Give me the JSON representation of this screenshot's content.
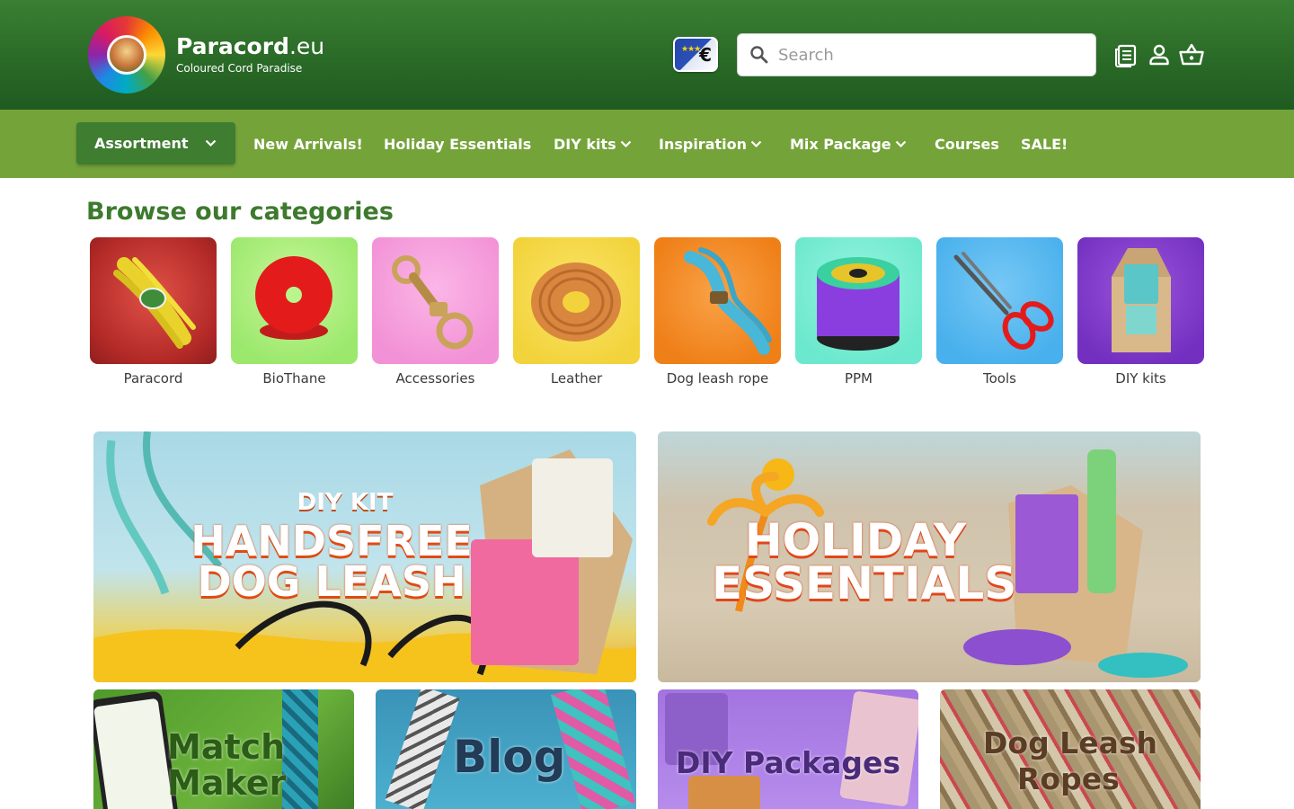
{
  "header": {
    "brand_name_bold": "Paracord",
    "brand_name_suffix": ".eu",
    "brand_tagline": "Coloured Cord Paradise",
    "region_symbol": "€",
    "search_placeholder": "Search"
  },
  "nav": {
    "assortment_label": "Assortment",
    "items": [
      {
        "label": "New Arrivals!",
        "has_dropdown": false
      },
      {
        "label": "Holiday Essentials",
        "has_dropdown": false
      },
      {
        "label": "DIY kits",
        "has_dropdown": true
      },
      {
        "label": "Inspiration",
        "has_dropdown": true
      },
      {
        "label": "Mix Package",
        "has_dropdown": true
      },
      {
        "label": "Courses",
        "has_dropdown": false
      },
      {
        "label": "SALE!",
        "has_dropdown": false
      }
    ]
  },
  "categories": {
    "title": "Browse our categories",
    "items": [
      {
        "label": "Paracord",
        "bg": "#c0302c"
      },
      {
        "label": "BioThane",
        "bg": "#a4f07a"
      },
      {
        "label": "Accessories",
        "bg": "#f59ad8"
      },
      {
        "label": "Leather",
        "bg": "#f5d843"
      },
      {
        "label": "Dog leash rope",
        "bg": "#f2821c"
      },
      {
        "label": "PPM",
        "bg": "#73ecd0"
      },
      {
        "label": "Tools",
        "bg": "#4fb4ee"
      },
      {
        "label": "DIY kits",
        "bg": "#7c3cc8"
      }
    ]
  },
  "banners": {
    "handsfree": {
      "line1": "DIY KIT",
      "line2": "HANDSFREE",
      "line3": "DOG LEASH"
    },
    "holiday": {
      "line1": "HOLIDAY",
      "line2": "ESSENTIALS"
    }
  },
  "promos": [
    {
      "line1": "Match",
      "line2": "Maker"
    },
    {
      "line1": "Blog",
      "line2": ""
    },
    {
      "line1": "DIY Packages",
      "line2": ""
    },
    {
      "line1": "Dog Leash",
      "line2": "Ropes"
    }
  ],
  "colors": {
    "header_green": "#2a6a27",
    "nav_green": "#74a33a",
    "assortment_green": "#3f7d31",
    "title_green": "#3d7a2e"
  }
}
